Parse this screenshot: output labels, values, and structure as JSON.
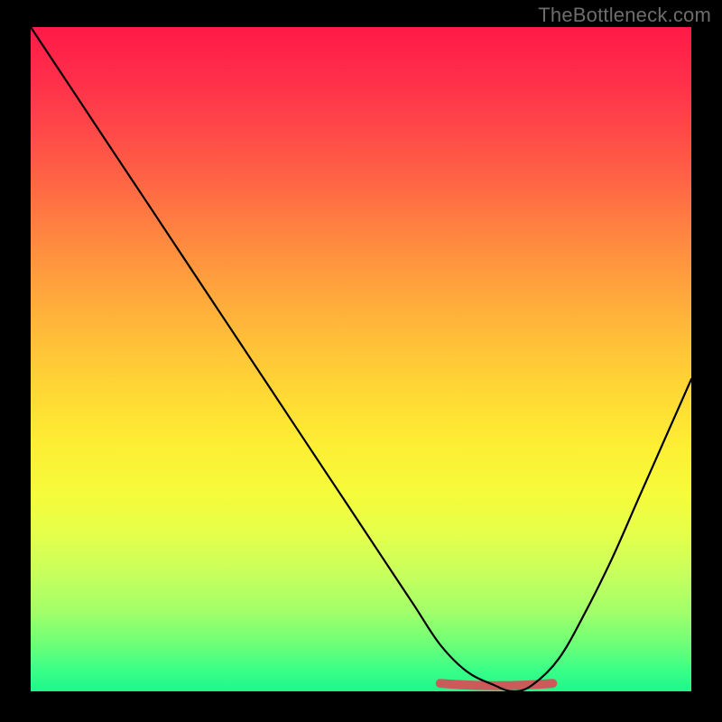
{
  "watermark": "TheBottleneck.com",
  "colors": {
    "page_bg": "#000000",
    "watermark_text": "#6d6d6d",
    "valley_range_stroke": "#cc5a5a",
    "curve_stroke": "#000000",
    "gradient_top": "#ff1a47",
    "gradient_bottom": "#20f58a"
  },
  "chart_data": {
    "type": "line",
    "title": "",
    "xlabel": "",
    "ylabel": "",
    "xlim": [
      0,
      100
    ],
    "ylim": [
      0,
      100
    ],
    "grid": false,
    "legend": false,
    "background": "red-to-green vertical gradient (high=red, low=green)",
    "series": [
      {
        "name": "bottleneck-curve",
        "x": [
          0,
          6,
          12,
          18,
          24,
          30,
          36,
          42,
          48,
          54,
          58,
          62,
          66,
          70,
          73,
          76,
          80,
          84,
          88,
          92,
          96,
          100
        ],
        "y": [
          100,
          91,
          82,
          73,
          64,
          55,
          46,
          37,
          28,
          19,
          13,
          7,
          3,
          1,
          0,
          1,
          5,
          12,
          20,
          29,
          38,
          47
        ]
      }
    ],
    "annotations": [
      {
        "name": "optimal-range",
        "type": "x-range",
        "x_start": 62,
        "x_end": 79,
        "y": 1.2,
        "color": "#cc5a5a"
      }
    ]
  }
}
